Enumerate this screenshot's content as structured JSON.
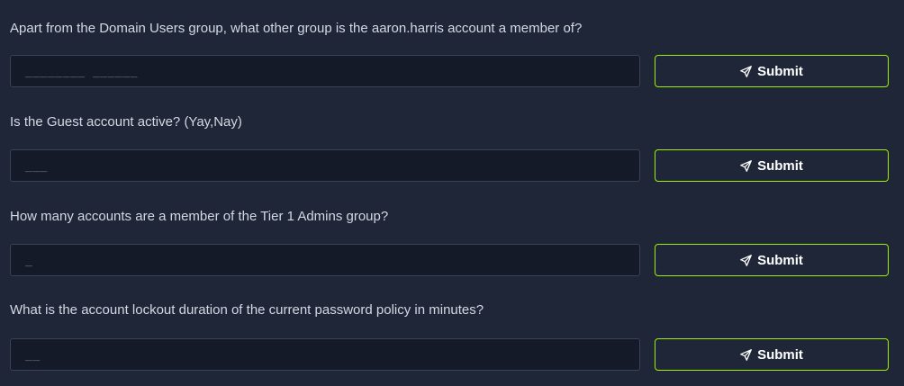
{
  "questions": [
    {
      "text": "Apart from the Domain Users group, what other group is the aaron.harris account a member of?",
      "answer_placeholder": "________ ______",
      "submit_label": "Submit"
    },
    {
      "text": "Is the Guest account active? (Yay,Nay)",
      "answer_placeholder": "___",
      "submit_label": "Submit"
    },
    {
      "text": "How many accounts are a member of the Tier 1 Admins group?",
      "answer_placeholder": "_",
      "submit_label": "Submit"
    },
    {
      "text": "What is the account lockout duration of the current password policy in minutes?",
      "answer_placeholder": "__",
      "submit_label": "Submit"
    }
  ],
  "icons": {
    "submit": "paper-plane-icon"
  },
  "colors": {
    "background": "#1f2638",
    "input_bg": "#141a27",
    "accent": "#9fef00"
  }
}
